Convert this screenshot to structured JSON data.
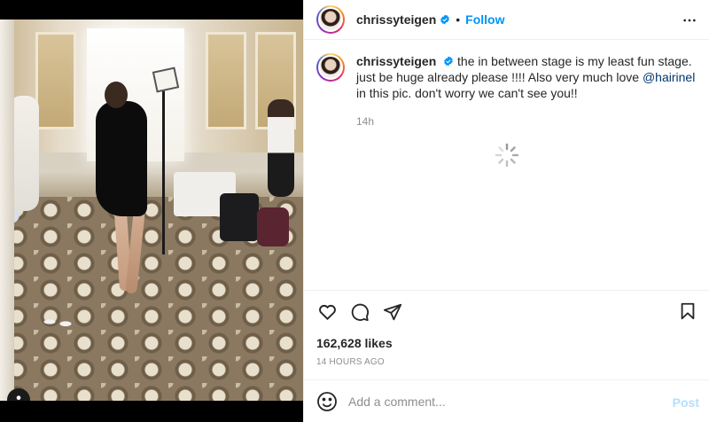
{
  "post": {
    "username": "chrissyteigen",
    "follow_label": "Follow",
    "separator": "•",
    "caption": {
      "username": "chrissyteigen",
      "text_before": "the in between stage is my least fun stage. just be huge already please !!!! Also very much love ",
      "mention": "@hairinel",
      "text_after": " in this pic. don't worry we can't see you!!"
    },
    "caption_time": "14h",
    "likes": "162,628 likes",
    "date": "14 HOURS AGO"
  },
  "comment": {
    "placeholder": "Add a comment...",
    "post_label": "Post"
  },
  "icons": {
    "verified": "verified-badge-icon",
    "more": "more-options-icon",
    "like": "heart-icon",
    "comment": "comment-icon",
    "share": "share-icon",
    "save": "bookmark-icon",
    "emoji": "emoji-icon",
    "tag": "user-tag-icon",
    "loading": "loading-spinner-icon"
  },
  "colors": {
    "link_blue": "#0095f6",
    "mention": "#00376b",
    "muted": "#8e8e8e",
    "post_disabled": "#b2dffc"
  }
}
